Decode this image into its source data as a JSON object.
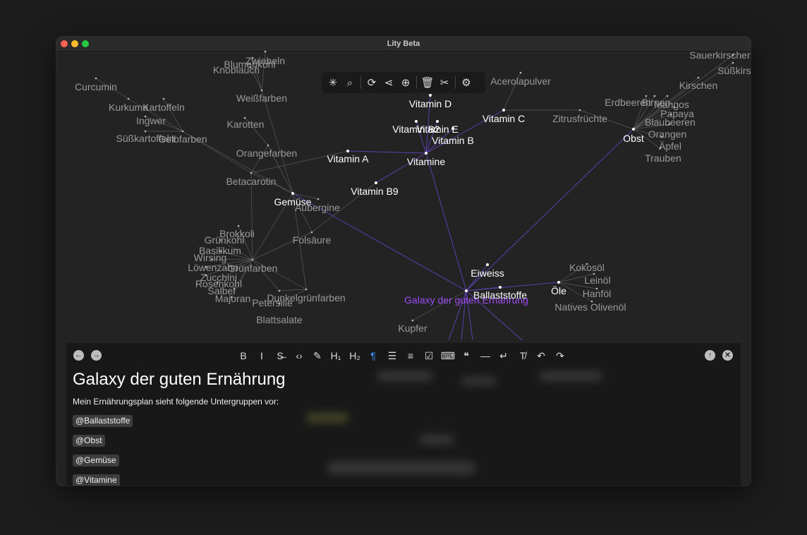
{
  "window": {
    "title": "Lity Beta"
  },
  "graph": {
    "nodes": [
      {
        "label": "Galaxy der guten Ernährung",
        "kind": "root"
      },
      {
        "label": "Vitamine",
        "kind": "primary"
      },
      {
        "label": "Vitamin D",
        "kind": "primary"
      },
      {
        "label": "Vitamin C",
        "kind": "primary"
      },
      {
        "label": "Vitamin E",
        "kind": "primary"
      },
      {
        "label": "Vitamin B2",
        "kind": "primary"
      },
      {
        "label": "Vitamin B",
        "kind": "primary"
      },
      {
        "label": "Vitamin A",
        "kind": "primary"
      },
      {
        "label": "Vitamin B9",
        "kind": "primary"
      },
      {
        "label": "Gemüse",
        "kind": "primary"
      },
      {
        "label": "Obst",
        "kind": "primary"
      },
      {
        "label": "Eiweiss",
        "kind": "primary"
      },
      {
        "label": "Ballaststoffe",
        "kind": "primary"
      },
      {
        "label": "Öle",
        "kind": "primary"
      },
      {
        "label": "Acerolapulver",
        "kind": "secondary"
      },
      {
        "label": "Zitrusfrüchte",
        "kind": "secondary"
      },
      {
        "label": "Sauerkirschen",
        "kind": "secondary"
      },
      {
        "label": "Süßkirschen",
        "kind": "secondary"
      },
      {
        "label": "Kirschen",
        "kind": "secondary"
      },
      {
        "label": "Erdbeeren",
        "kind": "secondary"
      },
      {
        "label": "Birnen",
        "kind": "secondary"
      },
      {
        "label": "Mangos",
        "kind": "secondary"
      },
      {
        "label": "Papaya",
        "kind": "secondary"
      },
      {
        "label": "Blaubeeren",
        "kind": "secondary"
      },
      {
        "label": "Orangen",
        "kind": "secondary"
      },
      {
        "label": "Äpfel",
        "kind": "secondary"
      },
      {
        "label": "Trauben",
        "kind": "secondary"
      },
      {
        "label": "Curcumin",
        "kind": "secondary"
      },
      {
        "label": "Kurkuma",
        "kind": "secondary"
      },
      {
        "label": "Kartoffeln",
        "kind": "secondary"
      },
      {
        "label": "Ingwer",
        "kind": "secondary"
      },
      {
        "label": "Süßkartoffeln",
        "kind": "secondary"
      },
      {
        "label": "Gelbfarben",
        "kind": "secondary"
      },
      {
        "label": "Blumenkohl",
        "kind": "secondary"
      },
      {
        "label": "Zwiebeln",
        "kind": "secondary"
      },
      {
        "label": "Knoblauch",
        "kind": "secondary"
      },
      {
        "label": "Weißfarben",
        "kind": "secondary"
      },
      {
        "label": "Karotten",
        "kind": "secondary"
      },
      {
        "label": "Orangefarben",
        "kind": "secondary"
      },
      {
        "label": "Betacarotin",
        "kind": "secondary"
      },
      {
        "label": "Aubergine",
        "kind": "secondary"
      },
      {
        "label": "Brokkoli",
        "kind": "secondary"
      },
      {
        "label": "Grünkohl",
        "kind": "secondary"
      },
      {
        "label": "Basilikum",
        "kind": "secondary"
      },
      {
        "label": "Wirsing",
        "kind": "secondary"
      },
      {
        "label": "Grünfarben",
        "kind": "secondary"
      },
      {
        "label": "Löwenzahn",
        "kind": "secondary"
      },
      {
        "label": "Zucchini",
        "kind": "secondary"
      },
      {
        "label": "Rosenkohl",
        "kind": "secondary"
      },
      {
        "label": "Salbei",
        "kind": "secondary"
      },
      {
        "label": "Majoran",
        "kind": "secondary"
      },
      {
        "label": "Petersilie",
        "kind": "secondary"
      },
      {
        "label": "Dunkelgrünfarben",
        "kind": "secondary"
      },
      {
        "label": "Blattsalate",
        "kind": "secondary"
      },
      {
        "label": "Folsäure",
        "kind": "secondary"
      },
      {
        "label": "Kupfer",
        "kind": "secondary"
      },
      {
        "label": "Kokosöl",
        "kind": "secondary"
      },
      {
        "label": "Leinöl",
        "kind": "secondary"
      },
      {
        "label": "Hanföl",
        "kind": "secondary"
      },
      {
        "label": "Natives Olivenöl",
        "kind": "secondary"
      }
    ]
  },
  "graph_toolbar": [
    {
      "icon": "asterisk-icon",
      "glyph": "✳"
    },
    {
      "icon": "search-icon",
      "glyph": "⌕"
    },
    {
      "icon": "refresh-icon",
      "glyph": "⟳"
    },
    {
      "icon": "share-icon",
      "glyph": "⋖"
    },
    {
      "icon": "add-circle-icon",
      "glyph": "⊕"
    },
    {
      "icon": "trash-icon",
      "glyph": "🗑"
    },
    {
      "icon": "scissors-icon",
      "glyph": "✂"
    },
    {
      "icon": "gear-icon",
      "glyph": "⚙"
    }
  ],
  "editor": {
    "toolbar": [
      {
        "icon": "bold-icon",
        "glyph": "B"
      },
      {
        "icon": "italic-icon",
        "glyph": "I"
      },
      {
        "icon": "strikethrough-icon",
        "glyph": "S̶"
      },
      {
        "icon": "inline-code-icon",
        "glyph": "‹›"
      },
      {
        "icon": "highlighter-icon",
        "glyph": "✎"
      },
      {
        "icon": "heading1-icon",
        "glyph": "H₁"
      },
      {
        "icon": "heading2-icon",
        "glyph": "H₂"
      },
      {
        "icon": "paragraph-icon",
        "glyph": "¶"
      },
      {
        "icon": "bullet-list-icon",
        "glyph": "☰"
      },
      {
        "icon": "numbered-list-icon",
        "glyph": "≡"
      },
      {
        "icon": "checklist-icon",
        "glyph": "☑"
      },
      {
        "icon": "code-block-icon",
        "glyph": "⌨"
      },
      {
        "icon": "quote-icon",
        "glyph": "❝"
      },
      {
        "icon": "horizontal-rule-icon",
        "glyph": "—"
      },
      {
        "icon": "line-break-icon",
        "glyph": "↵"
      },
      {
        "icon": "clear-format-icon",
        "glyph": "T̸"
      },
      {
        "icon": "undo-icon",
        "glyph": "↶"
      },
      {
        "icon": "redo-icon",
        "glyph": "↷"
      }
    ],
    "active_tool": "paragraph-icon",
    "title": "Galaxy der guten Ernährung",
    "intro": "Mein Ernährungsplan sieht folgende Untergruppen vor:",
    "mentions": [
      "@Ballaststoffe",
      "@Obst",
      "@Gemüse",
      "@Vitamine"
    ]
  },
  "colors": {
    "accent": "#9c4df4",
    "edge": "#5a5a5a",
    "accent_edge": "#5c3fb0",
    "primary_label": "#ffffff",
    "secondary_label": "#9a9a9a",
    "active_tool": "#3e8ef7"
  }
}
